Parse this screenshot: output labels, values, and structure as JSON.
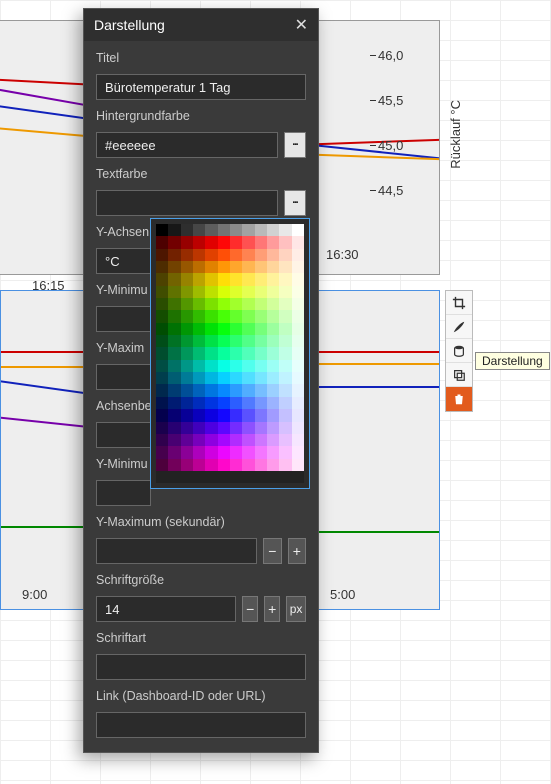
{
  "dialog": {
    "title": "Darstellung",
    "close_glyph": "✕",
    "fields": {
      "title_label": "Titel",
      "title_value": "Bürotemperatur 1 Tag",
      "bg_label": "Hintergrundfarbe",
      "bg_value": "#eeeeee",
      "text_label": "Textfarbe",
      "text_value": "",
      "yaxis_label": "Y-Achsen",
      "yaxis_value": "°C",
      "ymin_label": "Y-Minimu",
      "ymin_value": "",
      "ymax_label": "Y-Maxim",
      "ymax_value": "",
      "axislabel_label": "Achsenbe",
      "axislabel_value": "",
      "ymin2_label": "Y-Minimu",
      "ymin2_value": "",
      "ymax2_label": "Y-Maximum (sekundär)",
      "ymax2_value": "",
      "fontsize_label": "Schriftgröße",
      "fontsize_value": "14",
      "fontsize_unit": "px",
      "font_label": "Schriftart",
      "font_value": "",
      "link_label": "Link (Dashboard-ID oder URL)",
      "link_value": "",
      "minus": "−",
      "plus": "+",
      "dots": "···"
    }
  },
  "chart_data": [
    {
      "type": "line",
      "y_axis_label": "Rücklauf °C",
      "y_ticks": [
        "46,0",
        "45,5",
        "45,0",
        "44,5"
      ],
      "x_ticks": [
        "16:15",
        "16:30"
      ],
      "series_colors": [
        "#cc0000",
        "#1122bb",
        "#ee9900",
        "#7700aa"
      ]
    },
    {
      "type": "line",
      "x_ticks": [
        "9:00",
        "5:00"
      ],
      "series_colors": [
        "#cc0000",
        "#ee9900",
        "#1122bb",
        "#7700aa",
        "#008800"
      ]
    }
  ],
  "toolstrip": {
    "items": [
      {
        "name": "crop-icon",
        "glyph": "✂"
      },
      {
        "name": "brush-icon",
        "glyph": "✎"
      },
      {
        "name": "data-icon",
        "glyph": "≡"
      },
      {
        "name": "copy-icon",
        "glyph": "❐"
      },
      {
        "name": "trash-icon",
        "glyph": "🗑"
      }
    ],
    "tooltip": "Darstellung"
  }
}
